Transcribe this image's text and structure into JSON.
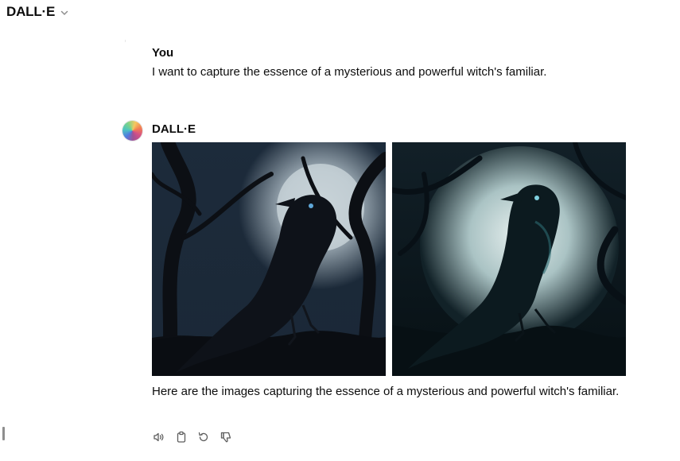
{
  "header": {
    "model_name": "DALL·E",
    "dropdown_icon": "chevron-down-icon"
  },
  "conversation": {
    "user_message": {
      "author": "You",
      "text": "I want to capture the essence of a mysterious and powerful witch's familiar."
    },
    "assistant_message": {
      "author": "DALL·E",
      "images": [
        {
          "subject": "raven-on-branch-moonlit-forest"
        },
        {
          "subject": "teal-raven-full-moon"
        }
      ],
      "text": "Here are the images capturing the essence of a mysterious and powerful witch's familiar."
    }
  },
  "message_actions": [
    {
      "icon": "speaker-icon"
    },
    {
      "icon": "clipboard-icon"
    },
    {
      "icon": "regenerate-icon"
    },
    {
      "icon": "thumbs-down-icon"
    }
  ],
  "colors": {
    "text": "#0d0d0d",
    "icon": "#5d5d5d",
    "background": "#ffffff"
  }
}
